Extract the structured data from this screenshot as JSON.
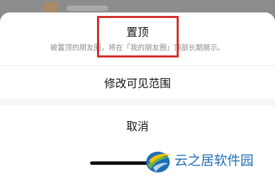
{
  "sheet": {
    "pin": {
      "title": "置顶",
      "description": "被置顶的朋友圈，将在「我的朋友圈」顶部长期展示。"
    },
    "edit_visibility": "修改可见范围",
    "cancel": "取消"
  },
  "watermark": {
    "text": "云之居软件园"
  },
  "colors": {
    "highlight": "#d42d2d",
    "watermark_blue": "#1e6fb8",
    "watermark_green": "#6ab04c",
    "watermark_yellow": "#f2c200"
  }
}
